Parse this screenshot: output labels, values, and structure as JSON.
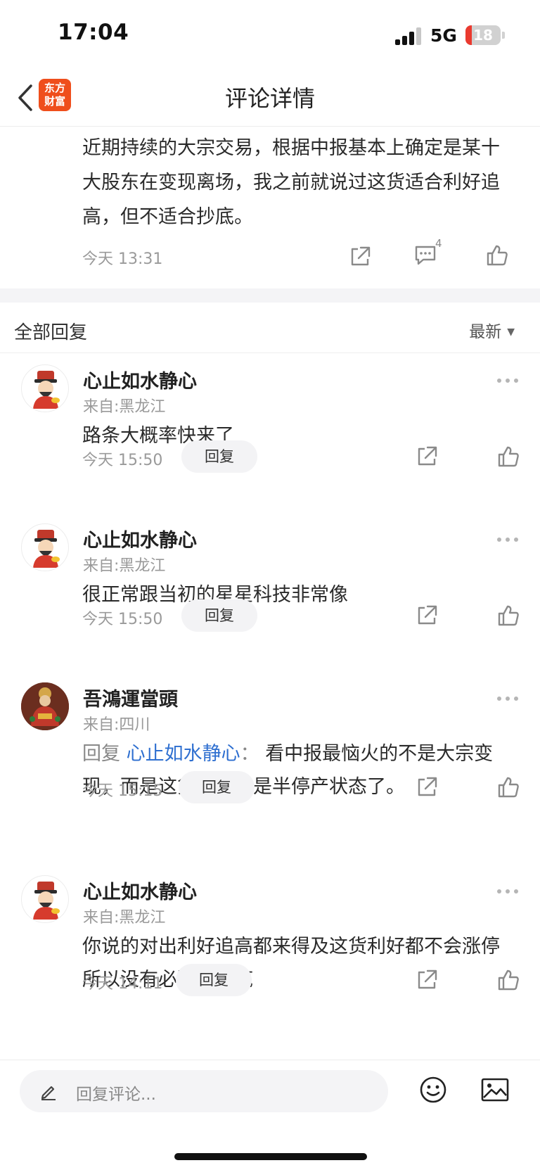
{
  "status_bar": {
    "time": "17:04",
    "network": "5G",
    "battery": "18",
    "battery_level": 0.18
  },
  "nav": {
    "title": "评论详情",
    "logo_line1": "东方",
    "logo_line2": "财富"
  },
  "post": {
    "text": "近期持续的大宗交易，根据中报基本上确定是某十大股东在变现离场，我之前就说过这货适合利好追高，但不适合抄底。",
    "time": "今天 13:31",
    "comment_count": "4"
  },
  "replies_section": {
    "title": "全部回复",
    "sort_label": "最新"
  },
  "replies": [
    {
      "username": "心止如水静心",
      "location": "来自:黑龙江",
      "text": "路条大概率快来了",
      "time": "今天 15:50",
      "reply_label": "回复"
    },
    {
      "username": "心止如水静心",
      "location": "来自:黑龙江",
      "text": "很正常跟当初的星星科技非常像",
      "time": "今天 15:50",
      "reply_label": "回复"
    },
    {
      "username": "吾鴻運當頭",
      "location": "来自:四川",
      "reply_prefix": "回复 ",
      "mention": "心止如水静心",
      "separator": "： ",
      "text": "看中报最恼火的不是大宗变现，而是这货基本上是半停产状态了。",
      "time": "今天 15:15",
      "reply_label": "回复"
    },
    {
      "username": "心止如水静心",
      "location": "来自:黑龙江",
      "text": "你说的对出利好追高都来得及这货利好都不会涨停所以没有必要去抄底",
      "time": "今天 14:11",
      "reply_label": "回复"
    }
  ],
  "bottom_bar": {
    "placeholder": "回复评论..."
  },
  "icons": {
    "back": "chevron-left-icon",
    "share": "share-icon",
    "comment": "comment-icon",
    "like": "thumbs-up-icon",
    "more": "more-dots-icon",
    "edit": "pencil-icon",
    "emoji": "smiley-icon",
    "image": "image-icon"
  },
  "colors": {
    "brand": "#ef4e1c",
    "mention": "#2e6fd0",
    "battery_low": "#ea3a2f"
  }
}
